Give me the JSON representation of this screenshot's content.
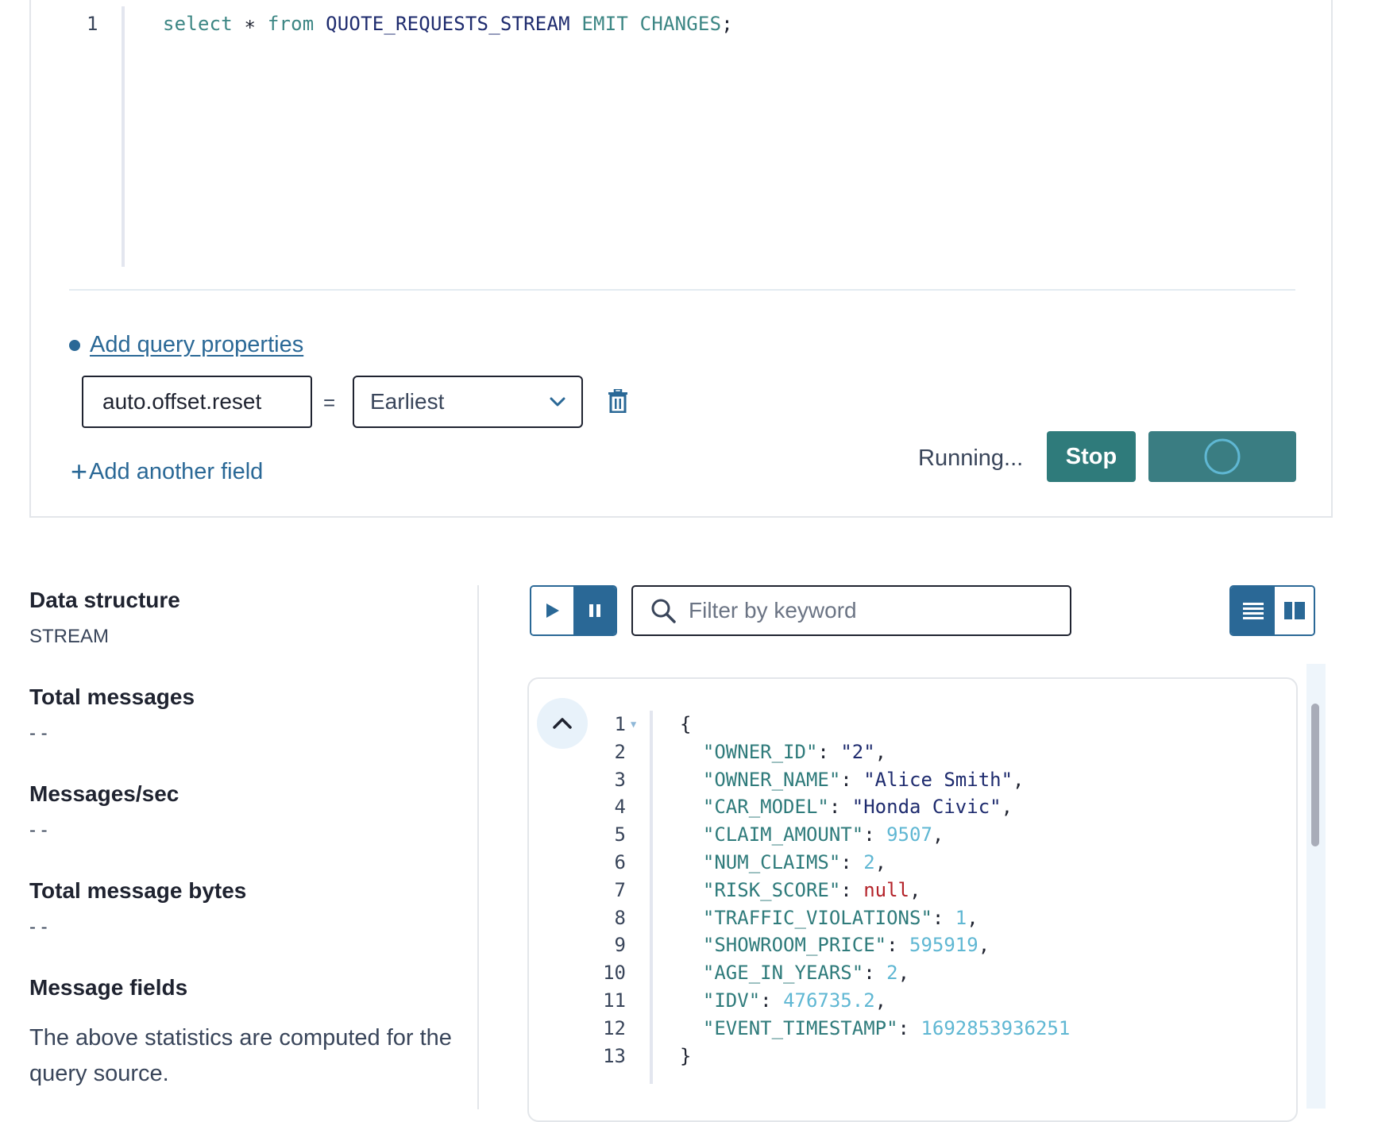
{
  "editor": {
    "line_number": "1",
    "query_tokens": [
      {
        "text": "select",
        "kind": "kw"
      },
      {
        "text": " ∗ ",
        "kind": "punct"
      },
      {
        "text": "from",
        "kind": "kw"
      },
      {
        "text": " QUOTE_REQUESTS_STREAM ",
        "kind": "ident"
      },
      {
        "text": "EMIT",
        "kind": "kw"
      },
      {
        "text": " ",
        "kind": "punct"
      },
      {
        "text": "CHANGES",
        "kind": "kw"
      },
      {
        "text": ";",
        "kind": "punct"
      }
    ]
  },
  "properties": {
    "add_link": "Add query properties",
    "key_value": "auto.offset.reset",
    "equals": "=",
    "selected_value": "Earliest",
    "add_field_label": "Add another field"
  },
  "run": {
    "status": "Running...",
    "stop_label": "Stop"
  },
  "stats": {
    "items": [
      {
        "label": "Data structure",
        "value": "STREAM"
      },
      {
        "label": "Total messages",
        "value": "- -"
      },
      {
        "label": "Messages/sec",
        "value": "- -"
      },
      {
        "label": "Total message bytes",
        "value": "- -"
      },
      {
        "label": "Message fields",
        "value": ""
      }
    ],
    "note": "The above statistics are computed for the query source."
  },
  "toolbar": {
    "filter_placeholder": "Filter by keyword"
  },
  "json_viewer": {
    "lines": [
      {
        "n": "1",
        "fold": true,
        "tokens": [
          {
            "t": "{",
            "c": "jp"
          }
        ]
      },
      {
        "n": "2",
        "tokens": [
          {
            "t": "  ",
            "c": "jp"
          },
          {
            "t": "\"OWNER_ID\"",
            "c": "jk"
          },
          {
            "t": ": ",
            "c": "jp"
          },
          {
            "t": "\"2\"",
            "c": "js"
          },
          {
            "t": ",",
            "c": "jp"
          }
        ]
      },
      {
        "n": "3",
        "tokens": [
          {
            "t": "  ",
            "c": "jp"
          },
          {
            "t": "\"OWNER_NAME\"",
            "c": "jk"
          },
          {
            "t": ": ",
            "c": "jp"
          },
          {
            "t": "\"Alice Smith\"",
            "c": "js"
          },
          {
            "t": ",",
            "c": "jp"
          }
        ]
      },
      {
        "n": "4",
        "tokens": [
          {
            "t": "  ",
            "c": "jp"
          },
          {
            "t": "\"CAR_MODEL\"",
            "c": "jk"
          },
          {
            "t": ": ",
            "c": "jp"
          },
          {
            "t": "\"Honda Civic\"",
            "c": "js"
          },
          {
            "t": ",",
            "c": "jp"
          }
        ]
      },
      {
        "n": "5",
        "tokens": [
          {
            "t": "  ",
            "c": "jp"
          },
          {
            "t": "\"CLAIM_AMOUNT\"",
            "c": "jk"
          },
          {
            "t": ": ",
            "c": "jp"
          },
          {
            "t": "9507",
            "c": "jn"
          },
          {
            "t": ",",
            "c": "jp"
          }
        ]
      },
      {
        "n": "6",
        "tokens": [
          {
            "t": "  ",
            "c": "jp"
          },
          {
            "t": "\"NUM_CLAIMS\"",
            "c": "jk"
          },
          {
            "t": ": ",
            "c": "jp"
          },
          {
            "t": "2",
            "c": "jn"
          },
          {
            "t": ",",
            "c": "jp"
          }
        ]
      },
      {
        "n": "7",
        "tokens": [
          {
            "t": "  ",
            "c": "jp"
          },
          {
            "t": "\"RISK_SCORE\"",
            "c": "jk"
          },
          {
            "t": ": ",
            "c": "jp"
          },
          {
            "t": "null",
            "c": "jnull"
          },
          {
            "t": ",",
            "c": "jp"
          }
        ]
      },
      {
        "n": "8",
        "tokens": [
          {
            "t": "  ",
            "c": "jp"
          },
          {
            "t": "\"TRAFFIC_VIOLATIONS\"",
            "c": "jk"
          },
          {
            "t": ": ",
            "c": "jp"
          },
          {
            "t": "1",
            "c": "jn"
          },
          {
            "t": ",",
            "c": "jp"
          }
        ]
      },
      {
        "n": "9",
        "tokens": [
          {
            "t": "  ",
            "c": "jp"
          },
          {
            "t": "\"SHOWROOM_PRICE\"",
            "c": "jk"
          },
          {
            "t": ": ",
            "c": "jp"
          },
          {
            "t": "595919",
            "c": "jn"
          },
          {
            "t": ",",
            "c": "jp"
          }
        ]
      },
      {
        "n": "10",
        "tokens": [
          {
            "t": "  ",
            "c": "jp"
          },
          {
            "t": "\"AGE_IN_YEARS\"",
            "c": "jk"
          },
          {
            "t": ": ",
            "c": "jp"
          },
          {
            "t": "2",
            "c": "jn"
          },
          {
            "t": ",",
            "c": "jp"
          }
        ]
      },
      {
        "n": "11",
        "tokens": [
          {
            "t": "  ",
            "c": "jp"
          },
          {
            "t": "\"IDV\"",
            "c": "jk"
          },
          {
            "t": ": ",
            "c": "jp"
          },
          {
            "t": "476735.2",
            "c": "jn"
          },
          {
            "t": ",",
            "c": "jp"
          }
        ]
      },
      {
        "n": "12",
        "tokens": [
          {
            "t": "  ",
            "c": "jp"
          },
          {
            "t": "\"EVENT_TIMESTAMP\"",
            "c": "jk"
          },
          {
            "t": ": ",
            "c": "jp"
          },
          {
            "t": "1692853936251",
            "c": "jn"
          }
        ]
      },
      {
        "n": "13",
        "tokens": [
          {
            "t": "}",
            "c": "jp"
          }
        ]
      }
    ]
  },
  "colors": {
    "accent": "#2a6896",
    "teal_button": "#2f7b7b",
    "json_key": "#2f7b7b",
    "json_string": "#1e2b6e",
    "json_number": "#5fb7d3",
    "json_null": "#b4232a"
  },
  "icons": {
    "delete": "trash-icon",
    "dropdown": "chevron-down-icon",
    "play": "play-icon",
    "pause": "pause-icon",
    "search": "search-icon",
    "list_view": "list-view-icon",
    "split_view": "split-view-icon",
    "collapse": "chevron-up-icon",
    "spinner": "loading-spinner-icon"
  }
}
